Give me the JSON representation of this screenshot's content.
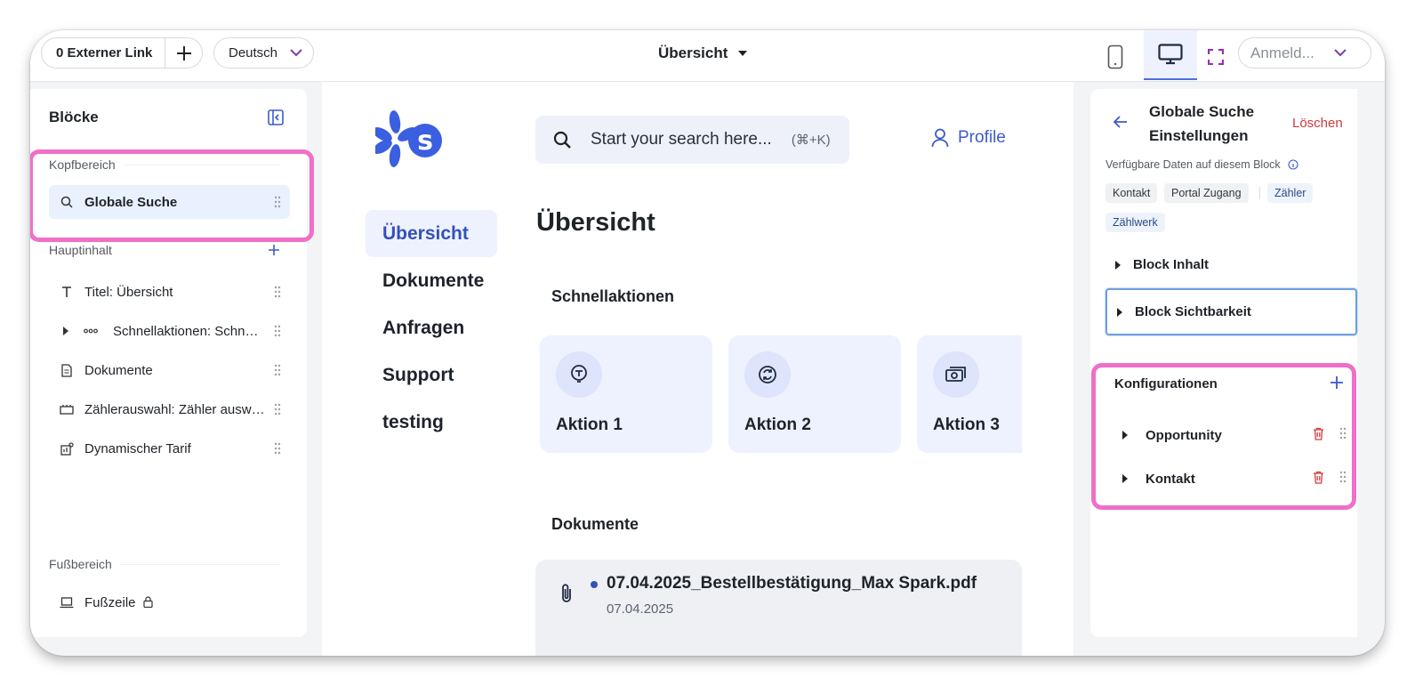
{
  "topbar": {
    "external_link_label": "0 Externer Link",
    "language": "Deutsch",
    "page_select": "Übersicht",
    "login_placeholder": "Anmeld..."
  },
  "left_panel": {
    "title": "Blöcke",
    "sections": {
      "header": "Kopfbereich",
      "main": "Hauptinhalt",
      "footer": "Fußbereich"
    },
    "header_items": [
      {
        "label": "Globale Suche",
        "icon": "search-icon"
      }
    ],
    "main_items": [
      {
        "label": "Titel: Übersicht",
        "icon": "text-icon"
      },
      {
        "label": "Schnellaktionen: Schnellaktionen",
        "icon": "dots-icon"
      },
      {
        "label": "Dokumente",
        "icon": "document-icon"
      },
      {
        "label": "Zählerauswahl: Zähler auswählen",
        "icon": "meter-icon"
      },
      {
        "label": "Dynamischer Tarif",
        "icon": "tariff-icon"
      }
    ],
    "footer_items": [
      {
        "label": "Fußzeile",
        "icon": "laptop-icon"
      }
    ]
  },
  "preview": {
    "search": {
      "placeholder": "Start your search here...",
      "shortcut": "(⌘+K)"
    },
    "profile_label": "Profile",
    "nav": [
      "Übersicht",
      "Dokumente",
      "Anfragen",
      "Support",
      "testing"
    ],
    "title": "Übersicht",
    "quick_actions_title": "Schnellaktionen",
    "actions": [
      "Aktion 1",
      "Aktion 2",
      "Aktion 3"
    ],
    "documents_title": "Dokumente",
    "document": {
      "name": "07.04.2025_Bestellbestätigung_Max Spark.pdf",
      "date": "07.04.2025"
    }
  },
  "right_panel": {
    "title": "Globale Suche Einstellungen",
    "delete_label": "Löschen",
    "available_data_label": "Verfügbare Daten auf diesem Block",
    "tags": [
      "Kontakt",
      "Portal Zugang",
      "Zähler",
      "Zählwerk"
    ],
    "accordions": [
      "Block Inhalt",
      "Block Sichtbarkeit"
    ],
    "configurations_title": "Konfigurationen",
    "configurations": [
      "Opportunity",
      "Kontakt"
    ]
  },
  "colors": {
    "accent": "#3451b8",
    "highlight": "#f06fc8",
    "danger": "#cc3b3b"
  }
}
